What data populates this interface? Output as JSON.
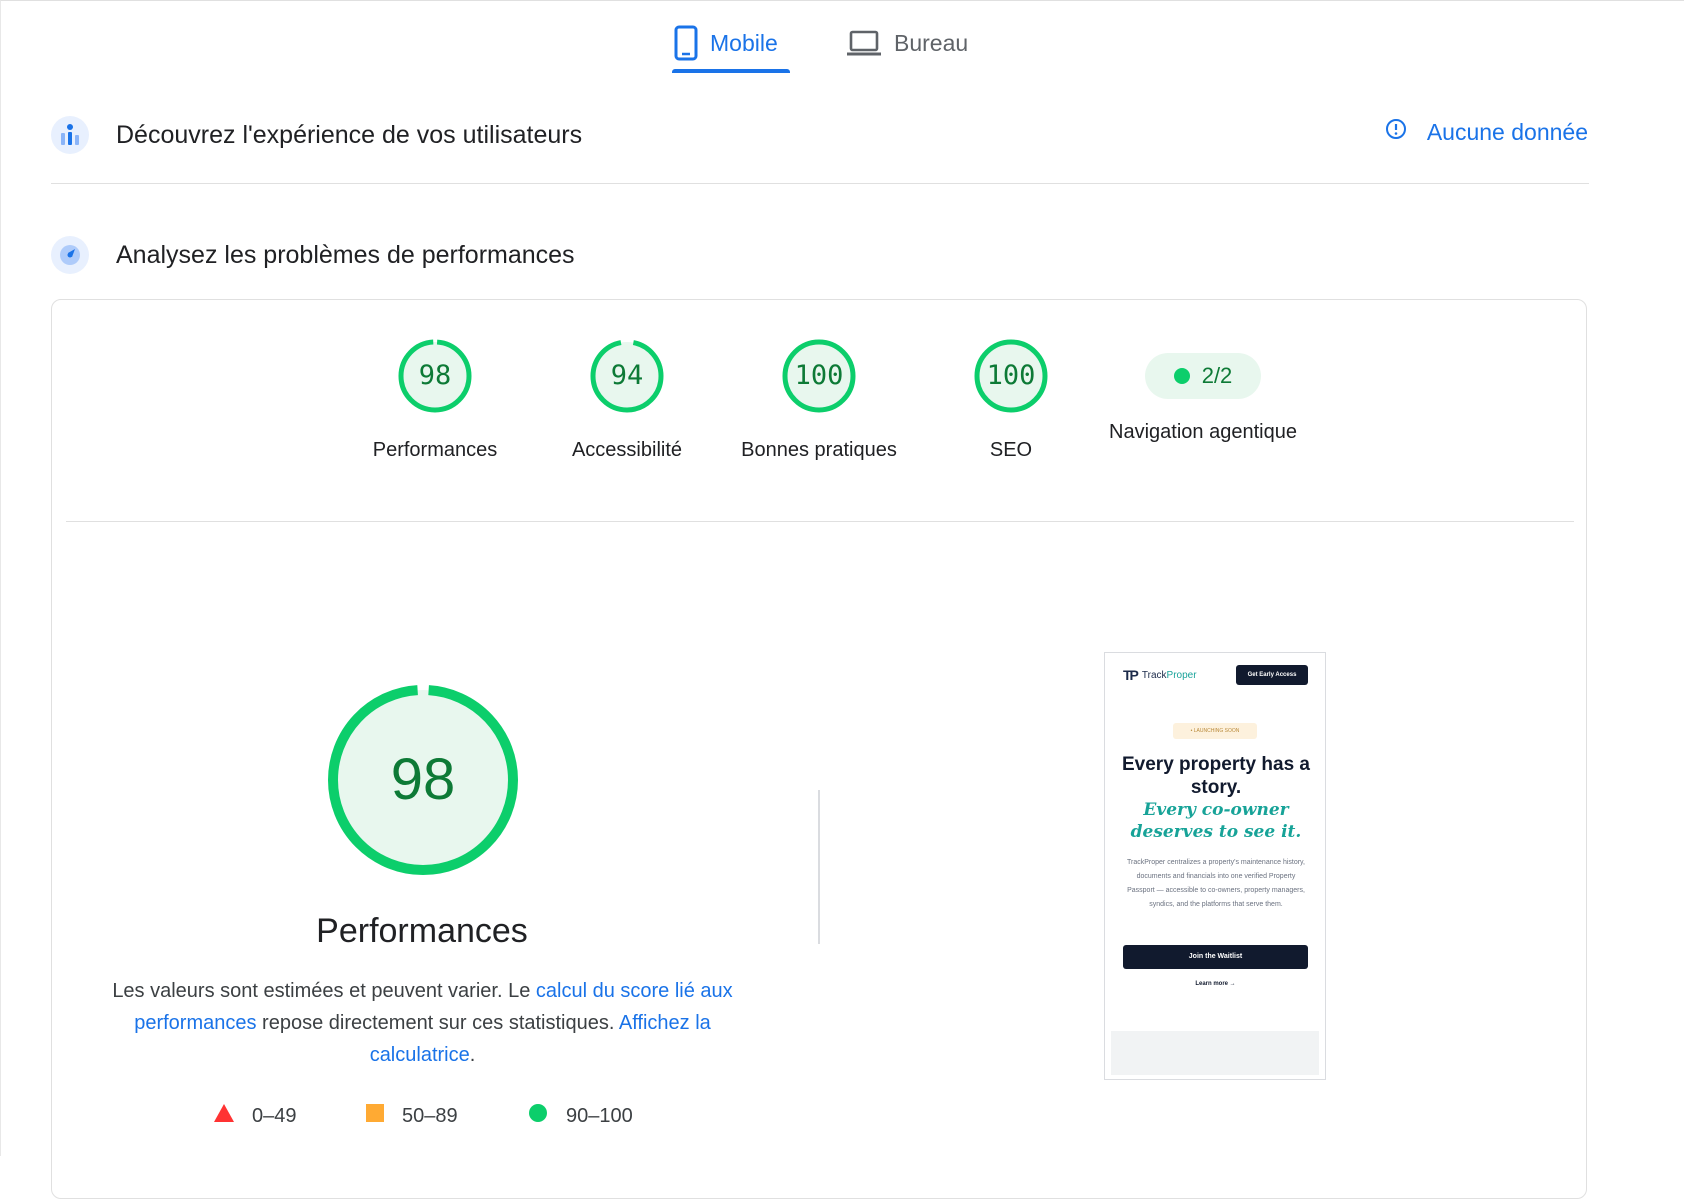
{
  "tabs": [
    {
      "label": "Mobile",
      "selected": true
    },
    {
      "label": "Bureau",
      "selected": false
    }
  ],
  "sections": {
    "users": {
      "title": "Découvrez l'expérience de vos utilisateurs",
      "status": "Aucune donnée"
    },
    "performance": {
      "title": "Analysez les problèmes de performances"
    }
  },
  "scores": [
    {
      "label": "Performances",
      "value": "98",
      "fraction": 0.98
    },
    {
      "label": "Accessibilité",
      "value": "94",
      "fraction": 0.94
    },
    {
      "label": "Bonnes pratiques",
      "value": "100",
      "fraction": 1.0
    },
    {
      "label": "SEO",
      "value": "100",
      "fraction": 1.0
    },
    {
      "label": "Navigation agentique",
      "value": "2/2"
    }
  ],
  "main": {
    "score": "98",
    "fraction": 0.98,
    "title": "Performances",
    "desc_1": "Les valeurs sont estimées et peuvent varier. Le ",
    "link_1": "calcul du score lié aux performances",
    "desc_2": " repose directement sur ces statistiques. ",
    "link_2": "Affichez la calculatrice",
    "desc_3": "."
  },
  "legend": [
    {
      "range": "0–49",
      "color": "#ff3333"
    },
    {
      "range": "50–89",
      "color": "#ffaa33"
    },
    {
      "range": "90–100",
      "color": "#0cce6b"
    }
  ],
  "colors": {
    "accent": "#1a73e8",
    "pass": "#0cce6b",
    "pass_text": "#0d7a36"
  },
  "screenshot": {
    "brand_mark": "TP",
    "brand_track": "Track",
    "brand_proper": "Proper",
    "cta_top": "Get Early Access",
    "badge": "• LAUNCHING SOON",
    "headline": "Every property has a story.",
    "headline_italic": "Every co-owner deserves to see it.",
    "body": "TrackProper centralizes a property's maintenance history, documents and financials into one verified Property Passport — accessible to co-owners, property managers, syndics, and the platforms that serve them.",
    "join": "Join the Waitlist",
    "learn": "Learn more →"
  }
}
